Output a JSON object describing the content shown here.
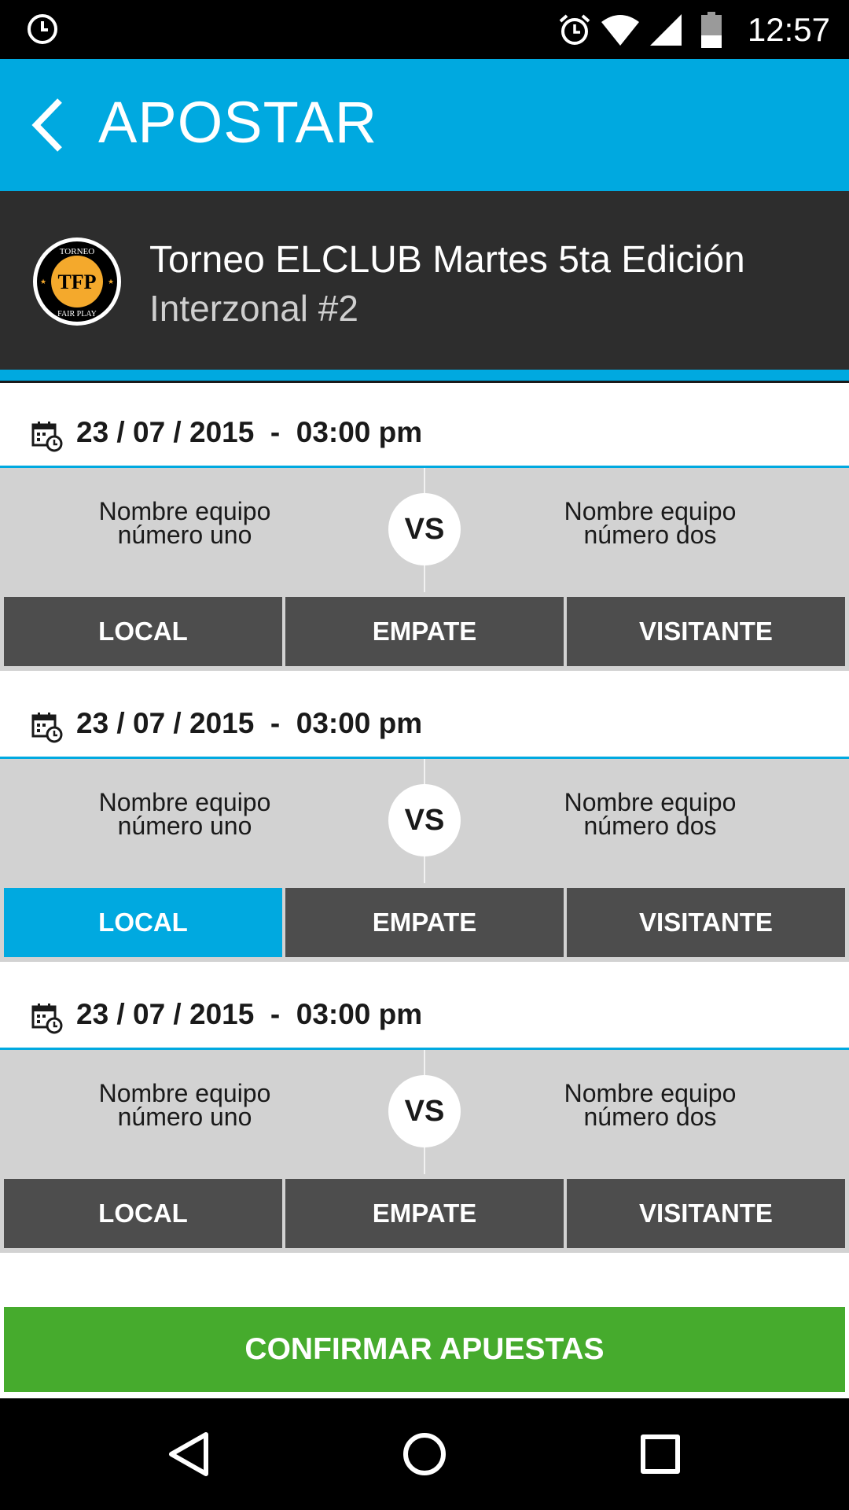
{
  "status_bar": {
    "time": "12:57",
    "icons": [
      "sync-clock-icon",
      "alarm-icon",
      "wifi-icon",
      "signal-icon",
      "battery-icon"
    ]
  },
  "app_bar": {
    "title": "APOSTAR",
    "back_icon": "chevron-left-icon"
  },
  "tournament": {
    "logo_text_top": "TORNEO",
    "logo_text_center": "TFP",
    "logo_text_bottom": "FAIR PLAY",
    "name": "Torneo ELCLUB Martes 5ta Edición",
    "subtitle": "Interzonal #2"
  },
  "matches": [
    {
      "date": "23 / 07 / 2015  -  03:00 pm",
      "home_line1": "Nombre equipo",
      "home_line2": "número uno",
      "vs": "VS",
      "away_line1": "Nombre equipo",
      "away_line2": "número dos",
      "local_label": "LOCAL",
      "empate_label": "EMPATE",
      "visitante_label": "VISITANTE",
      "selected": ""
    },
    {
      "date": "23 / 07 / 2015  -  03:00 pm",
      "home_line1": "Nombre equipo",
      "home_line2": "número uno",
      "vs": "VS",
      "away_line1": "Nombre equipo",
      "away_line2": "número dos",
      "local_label": "LOCAL",
      "empate_label": "EMPATE",
      "visitante_label": "VISITANTE",
      "selected": "local"
    },
    {
      "date": "23 / 07 / 2015  -  03:00 pm",
      "home_line1": "Nombre equipo",
      "home_line2": "número uno",
      "vs": "VS",
      "away_line1": "Nombre equipo",
      "away_line2": "número dos",
      "local_label": "LOCAL",
      "empate_label": "EMPATE",
      "visitante_label": "VISITANTE",
      "selected": ""
    }
  ],
  "confirm_label": "CONFIRMAR APUESTAS",
  "nav_bar": {
    "icons": [
      "back-triangle-icon",
      "home-circle-icon",
      "recents-square-icon"
    ]
  },
  "colors": {
    "accent": "#00a9e0",
    "dark": "#2d2d2d",
    "button": "#4d4d4d",
    "confirm": "#46ab2d",
    "logo_gold": "#f4a92c"
  }
}
